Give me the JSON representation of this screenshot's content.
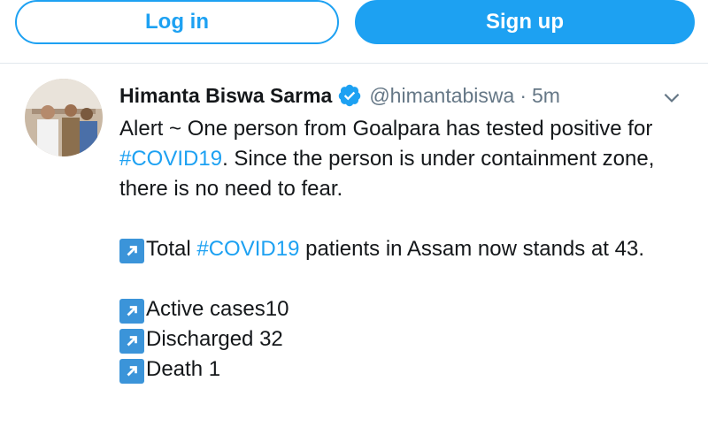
{
  "auth": {
    "login_label": "Log in",
    "signup_label": "Sign up"
  },
  "tweet": {
    "author_name": "Himanta Biswa Sarma",
    "handle": "@himantabiswa",
    "separator": "·",
    "time": "5m",
    "line1_text": "Alert ~ One person from Goalpara has tested positive for ",
    "line1_hashtag": "#COVID19",
    "line1_rest": ". Since the person is under containment zone, there is no need to fear.",
    "total_prefix": "Total ",
    "total_hashtag": "#COVID19",
    "total_rest": " patients in Assam now stands at 43.",
    "active": "Active cases10",
    "discharged": "Discharged 32",
    "death": "Death 1"
  },
  "colors": {
    "accent": "#1da1f2",
    "arrow_bg": "#3b94d9",
    "muted": "#657786"
  },
  "icons": {
    "verified": "verified-badge-icon",
    "caret": "chevron-down-icon",
    "arrow": "north-east-arrow-icon"
  }
}
